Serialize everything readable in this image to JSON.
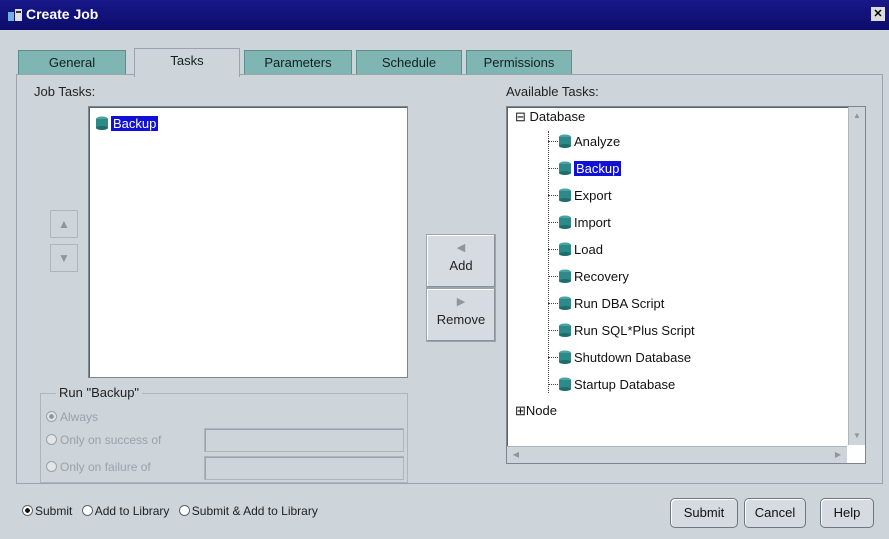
{
  "window": {
    "title": "Create Job",
    "close_glyph": "✕"
  },
  "tabs": [
    {
      "label": "General"
    },
    {
      "label": "Tasks",
      "active": true
    },
    {
      "label": "Parameters"
    },
    {
      "label": "Schedule"
    },
    {
      "label": "Permissions"
    }
  ],
  "job_tasks": {
    "label": "Job Tasks:",
    "items": [
      "Backup"
    ],
    "move_up_glyph": "▲",
    "move_down_glyph": "▼"
  },
  "middle": {
    "add_label": "Add",
    "add_arrow": "◀",
    "remove_label": "Remove",
    "remove_arrow": "▶"
  },
  "run_group": {
    "title": "Run \"Backup\"",
    "options": [
      {
        "label": "Always",
        "selected": true
      },
      {
        "label": "Only on success of",
        "selected": false
      },
      {
        "label": "Only on failure of",
        "selected": false
      }
    ]
  },
  "available_tasks": {
    "label": "Available Tasks:",
    "root": "Database",
    "expand_collapsed": "⊞",
    "expand_open": "⊟",
    "items": [
      "Analyze",
      "Backup",
      "Export",
      "Import",
      "Load",
      "Recovery",
      "Run DBA Script",
      "Run SQL*Plus Script",
      "Shutdown Database",
      "Startup Database"
    ],
    "selected_item": "Backup",
    "second_root": "Node"
  },
  "bottom": {
    "options": [
      {
        "label": "Submit",
        "selected": true
      },
      {
        "label": "Add to Library",
        "selected": false
      },
      {
        "label": "Submit & Add to Library",
        "selected": false
      }
    ],
    "submit_label": "Submit",
    "cancel_label": "Cancel",
    "help_label": "Help"
  },
  "colors": {
    "titlebar": "#10107a",
    "selection": "#1010d8",
    "tab_inactive": "#7fb5b3"
  }
}
